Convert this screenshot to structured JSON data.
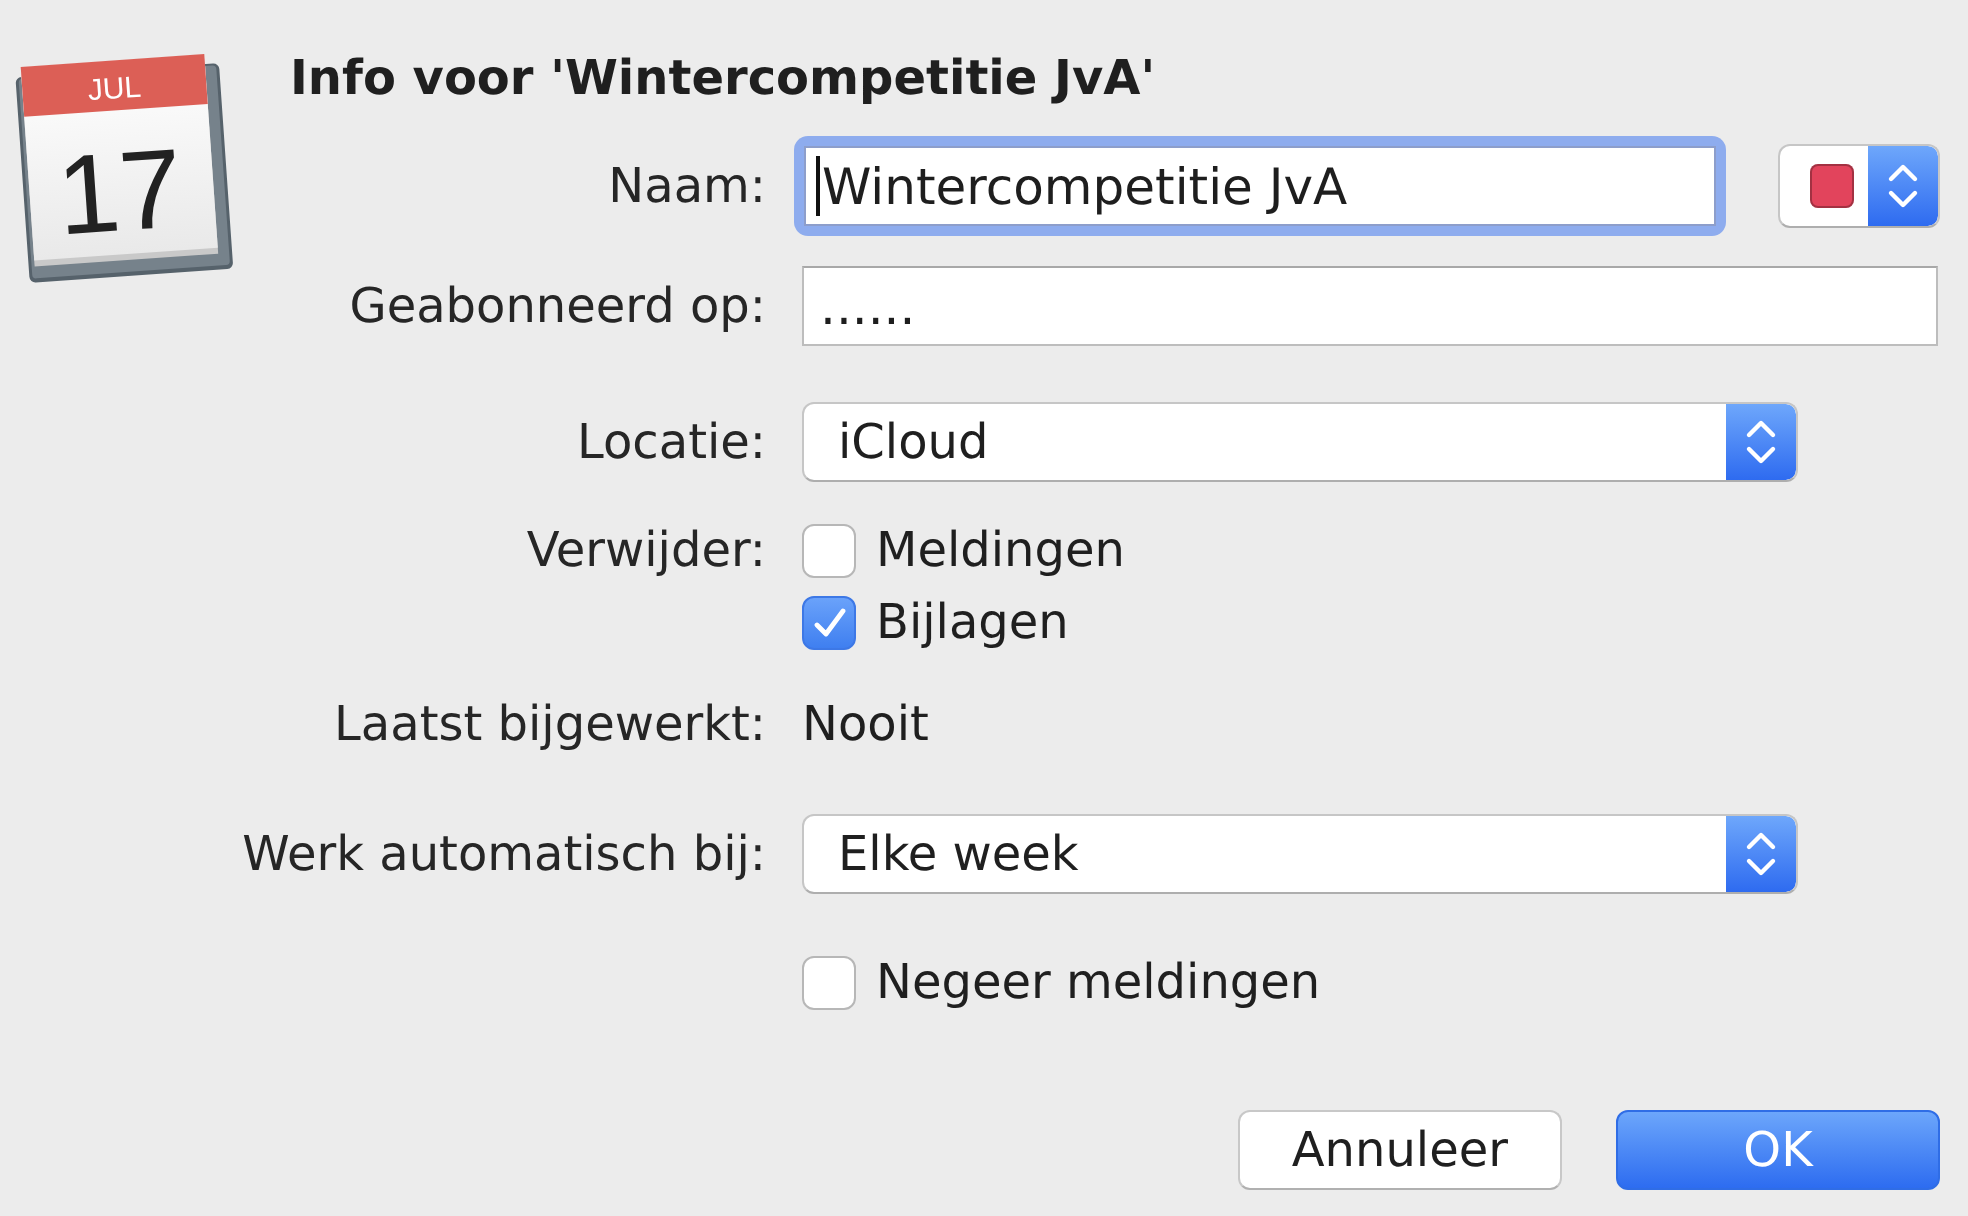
{
  "calendar_icon": {
    "month": "JUL",
    "day": "17"
  },
  "title": "Info voor 'Wintercompetitie JvA'",
  "rows": [
    {
      "kind": "text_field",
      "label": "Naam:",
      "value": "Wintercompetitie JvA",
      "focused": true,
      "color_popup": {
        "color": "#e2445c"
      }
    },
    {
      "kind": "text_field",
      "label": "Geabonneerd op:",
      "value": "......",
      "focused": false
    },
    {
      "kind": "popup",
      "label": "Locatie:",
      "value": "iCloud"
    },
    {
      "kind": "checkboxes",
      "label": "Verwijder:",
      "options": [
        {
          "label": "Meldingen",
          "checked": false
        },
        {
          "label": "Bijlagen",
          "checked": true
        }
      ]
    },
    {
      "kind": "static",
      "label": "Laatst bijgewerkt:",
      "value": "Nooit"
    },
    {
      "kind": "popup",
      "label": "Werk automatisch bij:",
      "value": "Elke week"
    },
    {
      "kind": "checkboxes",
      "options": [
        {
          "label": "Negeer meldingen",
          "checked": false
        }
      ]
    }
  ],
  "buttons": [
    {
      "label": "Annuleer",
      "default": false
    },
    {
      "label": "OK",
      "default": true
    }
  ]
}
